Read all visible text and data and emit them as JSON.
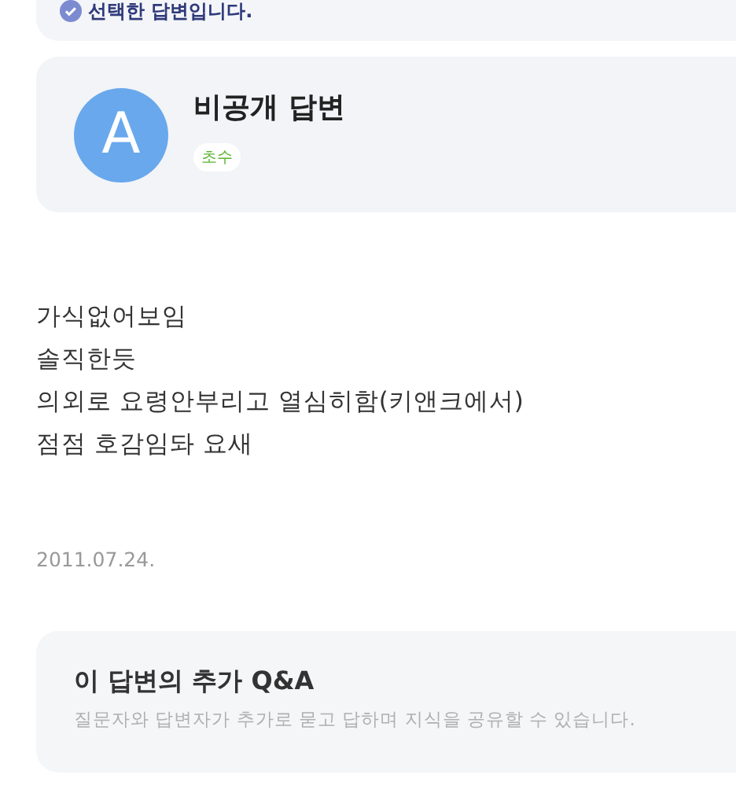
{
  "selected_notice": {
    "text": "선택한 답변입니다."
  },
  "answer": {
    "avatar_letter": "A",
    "author": "비공개 답변",
    "badge": "초수",
    "body_lines": [
      "가식없어보임",
      "솔직한듯",
      "의외로 요령안부리고 열심히함(키앤크에서)",
      "점점 호감임돠 요새"
    ],
    "date": "2011.07.24."
  },
  "extra_qa": {
    "title": "이 답변의 추가 Q&A",
    "description": "질문자와 답변자가 추가로 묻고 답하며 지식을 공유할 수 있습니다."
  }
}
